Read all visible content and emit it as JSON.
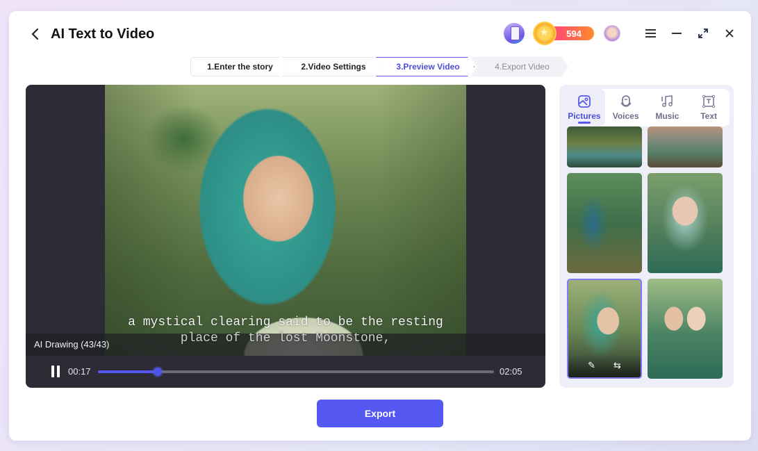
{
  "header": {
    "title": "AI Text to Video",
    "coins": "594"
  },
  "steps": [
    {
      "label": "1.Enter the story",
      "state": "done"
    },
    {
      "label": "2.Video Settings",
      "state": "done"
    },
    {
      "label": "3.Preview Video",
      "state": "active"
    },
    {
      "label": "4.Export Video",
      "state": "pending"
    }
  ],
  "player": {
    "subtitle_line1": "a mystical clearing said to be the resting",
    "subtitle_line2": "place of the lost Moonstone,",
    "caption": "AI Drawing  (43/43)",
    "current_time": "00:17",
    "total_time": "02:05",
    "progress_percent": 15
  },
  "side_panel": {
    "tabs": [
      {
        "label": "Pictures",
        "icon": "picture-icon",
        "active": true
      },
      {
        "label": "Voices",
        "icon": "microphone-icon",
        "active": false
      },
      {
        "label": "Music",
        "icon": "music-note-icon",
        "active": false
      },
      {
        "label": "Text",
        "icon": "text-box-icon",
        "active": false
      }
    ],
    "selected_thumbnail": 5,
    "thumbnail_actions": [
      "edit-icon",
      "swap-icon"
    ]
  },
  "export_label": "Export",
  "colors": {
    "accent": "#5458f0",
    "active_step": "#4d4ddb",
    "coin_gradient_start": "#ff3d7f",
    "coin_gradient_end": "#ff8b2e"
  }
}
